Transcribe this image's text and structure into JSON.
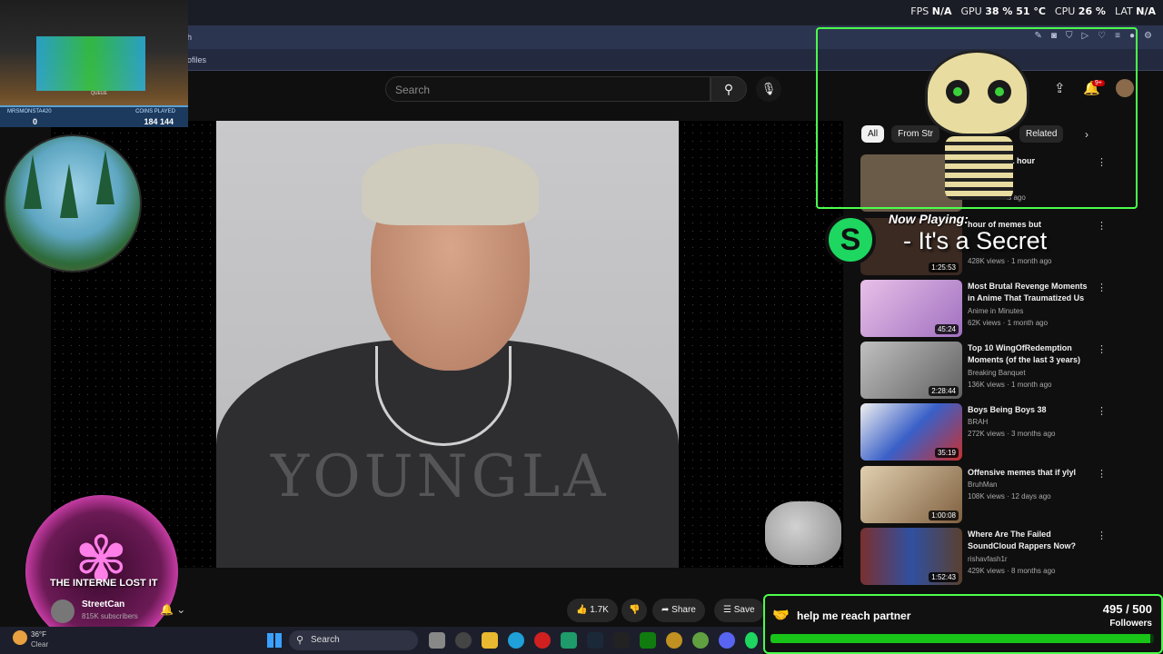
{
  "overlay_stats": {
    "fps_label": "FPS",
    "fps_value": "N/A",
    "gpu_label": "GPU",
    "gpu_value": "38 % 51 °C",
    "cpu_label": "CPU",
    "cpu_value": "26 %",
    "lat_label": "LAT",
    "lat_value": "N/A"
  },
  "browser": {
    "address_fragment": "h",
    "bookmark_fragment": "ofiles"
  },
  "youtube": {
    "search_placeholder": "Search",
    "notification_count": "9+",
    "chips": [
      "All",
      "From Str",
      "Related"
    ],
    "recommended": [
      {
        "title": "start, 1 hour",
        "channel": "",
        "meta": "months ago",
        "duration": "",
        "thumb_color": "#6a5a48"
      },
      {
        "title": "hour of memes but",
        "channel": "",
        "meta": "428K views · 1 month ago",
        "duration": "1:25:53",
        "thumb_color": "#3b2a22"
      },
      {
        "title": "Most Brutal Revenge Moments in Anime That Traumatized Us",
        "channel": "Anime in Minutes",
        "meta": "62K views · 1 month ago",
        "duration": "45:24",
        "thumb_color": "#c9a8d8"
      },
      {
        "title": "Top 10 WingOfRedemption Moments (of the last 3 years)",
        "channel": "Breaking Banquet",
        "meta": "136K views · 1 month ago",
        "duration": "2:28:44",
        "thumb_color": "#8c8c8c"
      },
      {
        "title": "Boys Being Boys 38",
        "channel": "BRAH",
        "meta": "272K views · 3 months ago",
        "duration": "35:19",
        "thumb_color": "#3a60c8"
      },
      {
        "title": "Offensive memes that if ylyl",
        "channel": "BruhMan",
        "meta": "108K views · 12 days ago",
        "duration": "1:00:08",
        "thumb_color": "#b09070"
      },
      {
        "title": "Where Are The Failed SoundCloud Rappers Now?",
        "channel": "rishavfash1r",
        "meta": "429K views · 8 months ago",
        "duration": "1:52:43",
        "thumb_color": "#7a3030"
      }
    ],
    "video_title": "THE INTERNE LOST IT",
    "channel_name": "StreetCan",
    "channel_subs": "815K subscribers",
    "like_count": "1.7K",
    "share_label": "Share",
    "save_label": "Save"
  },
  "video": {
    "shirt_text": "YOUNGLA"
  },
  "now_playing": {
    "label": "Now Playing:",
    "song": "- It's a Secret",
    "logo_letter": "S"
  },
  "game": {
    "left_label": "MRSMONSTA420",
    "left_value": "0",
    "right_label": "COINS PLAYED",
    "right_value": "184 144",
    "queue_label": "QUEUE"
  },
  "taskbar": {
    "temperature": "36°F",
    "weather": "Clear",
    "search_label": "Search"
  },
  "partner_goal": {
    "title": "help me reach partner",
    "count_text": "495 / 500",
    "unit": "Followers",
    "progress": 0.99
  },
  "colors": {
    "accent_green": "#4cff4c",
    "youtube_bg": "#0f0f0f",
    "spotify_green": "#1ed760"
  }
}
